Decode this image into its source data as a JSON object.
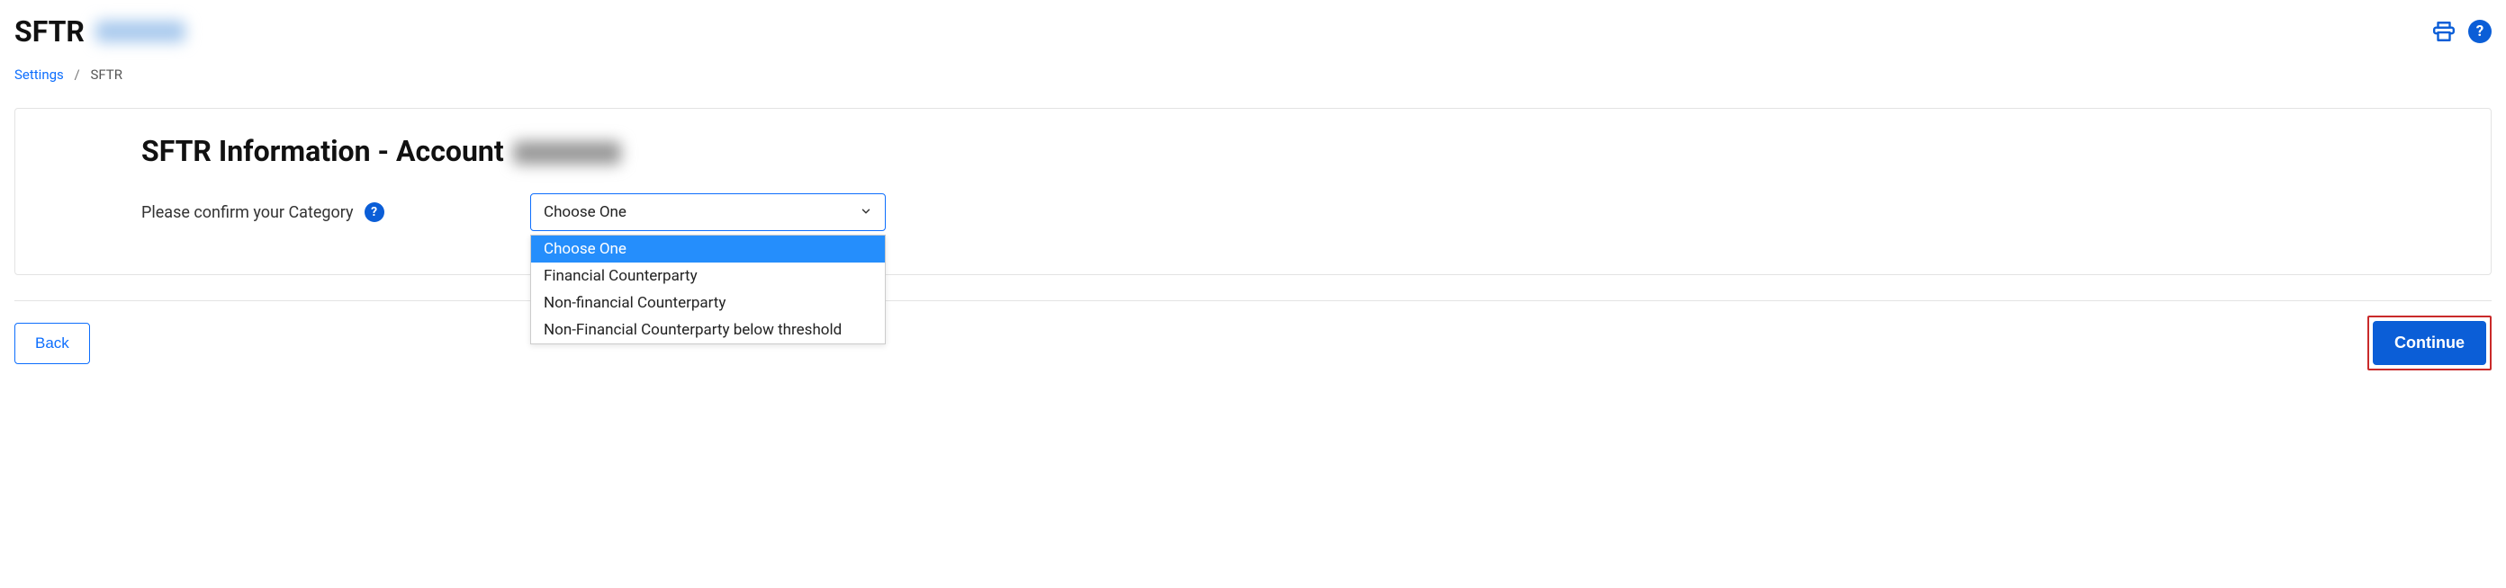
{
  "header": {
    "title": "SFTR"
  },
  "breadcrumb": {
    "root": "Settings",
    "separator": "/",
    "current": "SFTR"
  },
  "card": {
    "title": "SFTR Information - Account",
    "form": {
      "label": "Please confirm your Category",
      "info_symbol": "?",
      "select": {
        "value": "Choose One",
        "options": [
          "Choose One",
          "Financial Counterparty",
          "Non-financial Counterparty",
          "Non-Financial Counterparty below threshold"
        ]
      }
    }
  },
  "footer": {
    "back_label": "Back",
    "continue_label": "Continue"
  },
  "icons": {
    "help_symbol": "?"
  }
}
